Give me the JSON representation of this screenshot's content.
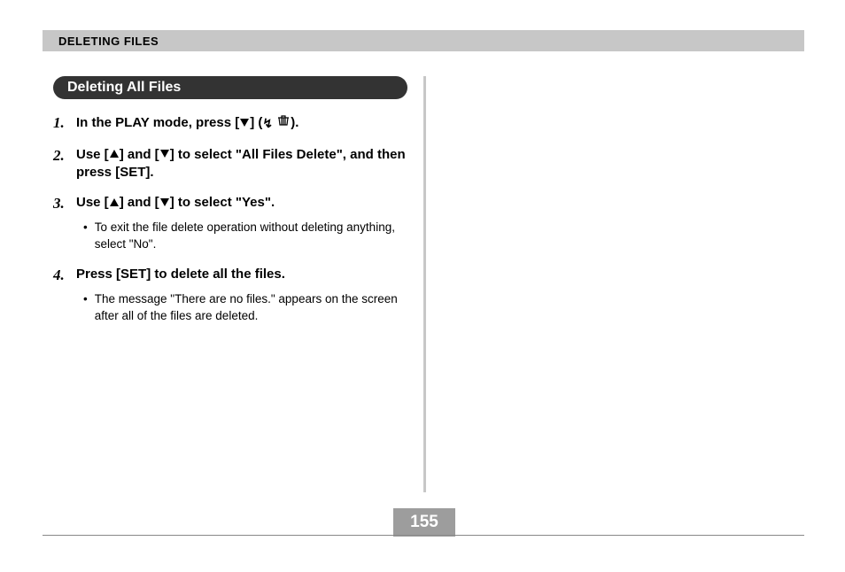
{
  "header": {
    "title": "DELETING FILES"
  },
  "section": {
    "title": "Deleting All Files"
  },
  "steps": [
    {
      "num": "1.",
      "text_before": "In the PLAY mode, press [",
      "text_after": "] (",
      "text_end": ").",
      "bullets": []
    },
    {
      "num": "2.",
      "text_before": "Use [",
      "text_mid1": "] and [",
      "text_mid2": "] to select \"All Files Delete\", and then press [SET].",
      "bullets": []
    },
    {
      "num": "3.",
      "text_before": "Use [",
      "text_mid1": "] and [",
      "text_mid2": "] to select \"Yes\".",
      "bullets": [
        "To exit the file delete operation without deleting anything, select \"No\"."
      ]
    },
    {
      "num": "4.",
      "text_plain": "Press [SET] to delete all the files.",
      "bullets": [
        "The message \"There are no files.\" appears on the screen after all of the files are deleted."
      ]
    }
  ],
  "page_number": "155"
}
